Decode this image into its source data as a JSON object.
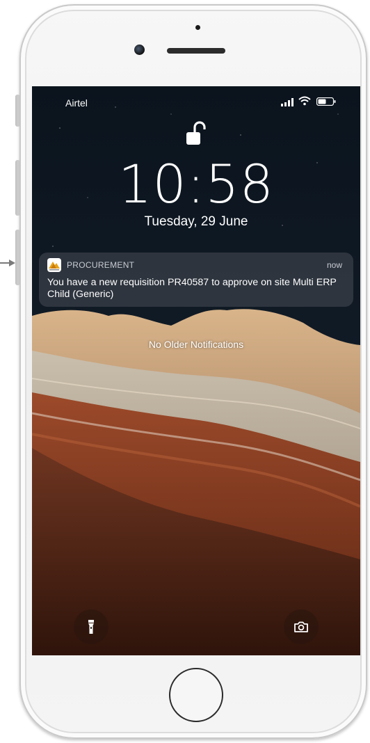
{
  "status_bar": {
    "carrier": "Airtel",
    "signal_icon": "signal-bars-icon",
    "wifi_icon": "wifi-icon",
    "battery_icon": "battery-icon"
  },
  "lock_screen": {
    "lock_icon": "unlocked-padlock-icon",
    "time": "10:58",
    "date": "Tuesday, 29 June",
    "no_older_notifications": "No Older Notifications"
  },
  "notification": {
    "app_name": "PROCUREMENT",
    "time": "now",
    "body": "You have a new requisition PR40587 to approve on site Multi ERP Child (Generic)",
    "app_icon": "procurement-app-icon"
  },
  "quick_actions": {
    "flashlight_icon": "flashlight-icon",
    "camera_icon": "camera-icon"
  },
  "colors": {
    "notification_bg": "#3a404a",
    "text": "#ffffff"
  }
}
